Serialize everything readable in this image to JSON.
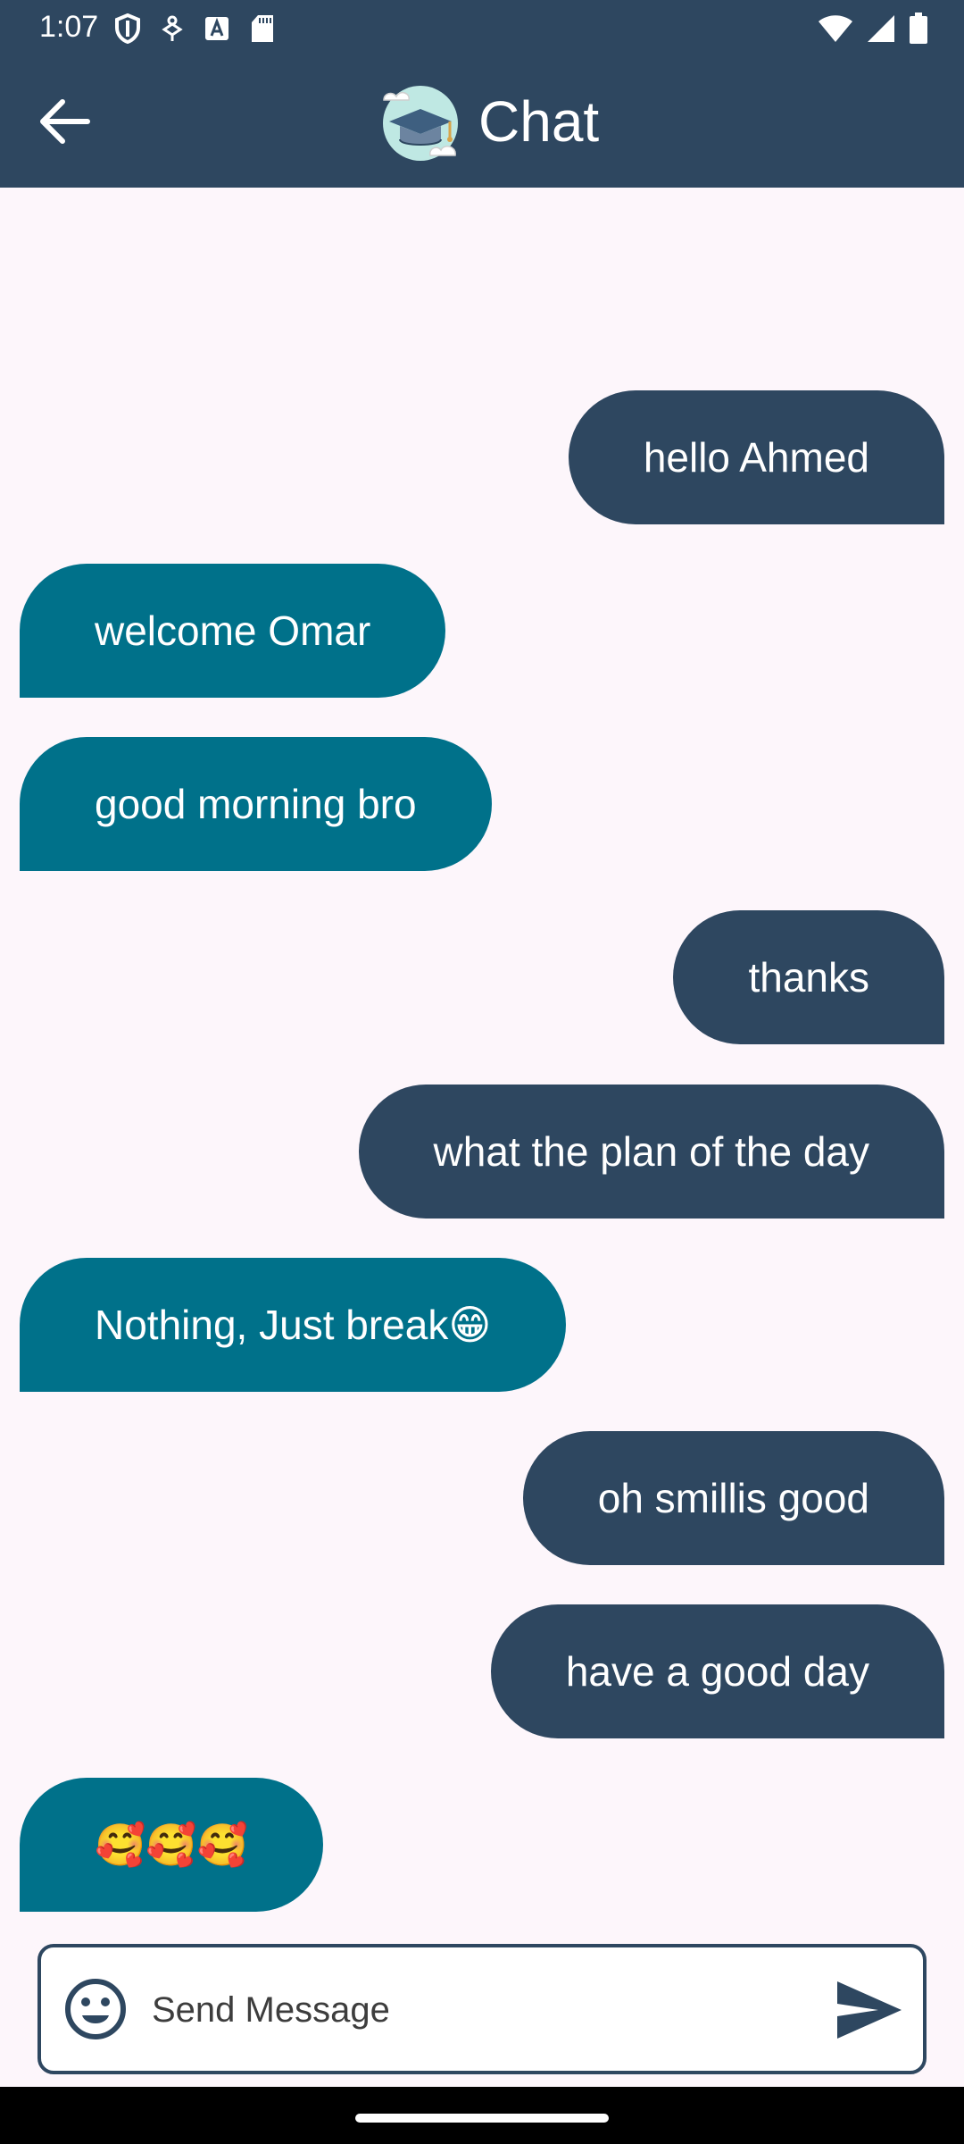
{
  "status_bar": {
    "time": "1:07",
    "icons_left": [
      "shield-icon",
      "vpn-key-icon",
      "font-download-icon",
      "sd-card-icon"
    ],
    "icons_right": [
      "wifi-icon",
      "signal-icon",
      "battery-icon"
    ]
  },
  "app_bar": {
    "title": "Chat",
    "back_icon": "arrow-back-icon",
    "logo": "graduation-cap-cloud-logo"
  },
  "messages": [
    {
      "text": "hello Ahmed",
      "direction": "sent"
    },
    {
      "text": "welcome Omar",
      "direction": "received"
    },
    {
      "text": "good morning bro",
      "direction": "received"
    },
    {
      "text": "thanks",
      "direction": "sent"
    },
    {
      "text": "what the plan of the day",
      "direction": "sent"
    },
    {
      "text": "Nothing, Just break😁",
      "direction": "received"
    },
    {
      "text": "oh smillis good",
      "direction": "sent"
    },
    {
      "text": "have a good day",
      "direction": "sent"
    },
    {
      "text": "🥰🥰🥰",
      "direction": "received"
    }
  ],
  "composer": {
    "placeholder": "Send Message",
    "value": "",
    "emoji_icon": "emoji-icon",
    "send_icon": "send-icon"
  },
  "colors": {
    "primary": "#2e4760",
    "received_bubble": "#00718a",
    "background": "#fdf6fb",
    "text_on_bubble": "#ffffff"
  }
}
